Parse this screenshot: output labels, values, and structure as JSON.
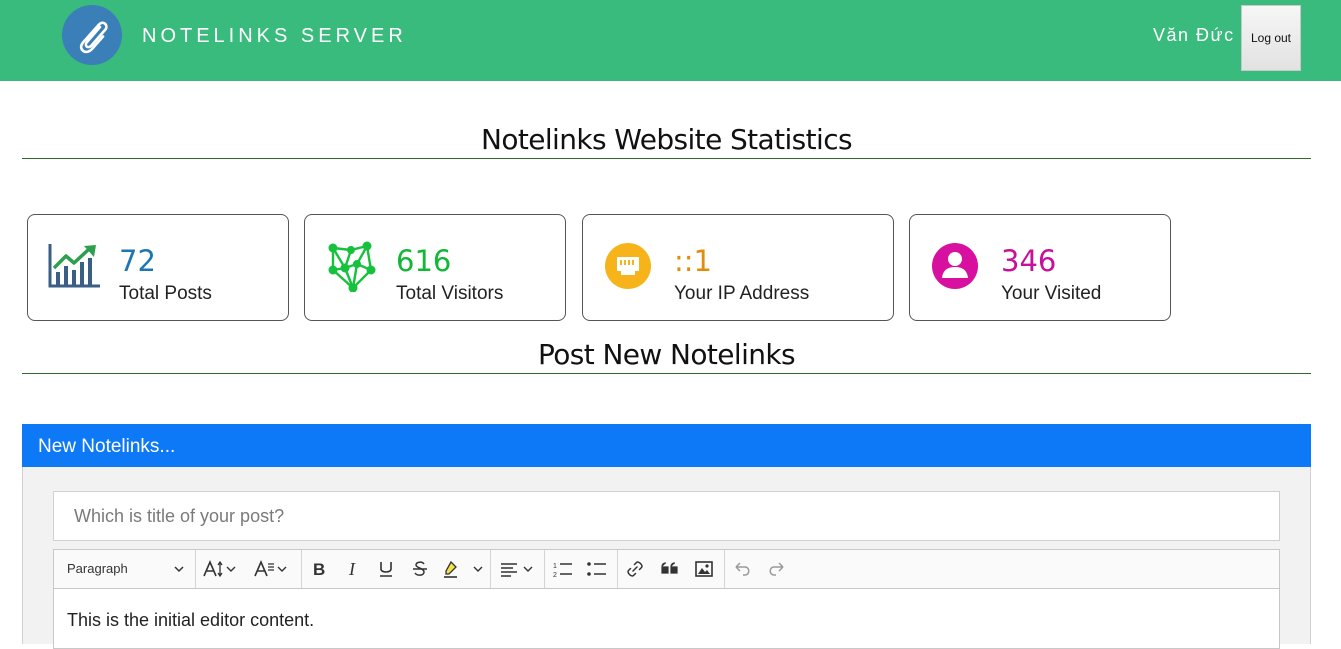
{
  "header": {
    "brand": "NOTELINKS SERVER",
    "username": "Văn Đức",
    "logout_label": "Log out",
    "logo_icon": "paperclip-icon",
    "bg_color": "#38bb7c"
  },
  "stats": {
    "title": "Notelinks Website Statistics",
    "cards": [
      {
        "icon": "chart-growth-icon",
        "value": "72",
        "label": "Total Posts",
        "color": "#1b76b3"
      },
      {
        "icon": "network-icon",
        "value": "616",
        "label": "Total Visitors",
        "color": "#12b737"
      },
      {
        "icon": "ethernet-port-icon",
        "value": "::1",
        "label": "Your IP Address",
        "color": "#e48c0a"
      },
      {
        "icon": "user-icon",
        "value": "346",
        "label": "Your Visited",
        "color": "#c7109c"
      }
    ]
  },
  "post": {
    "section_title": "Post New Notelinks",
    "panel_title": "New Notelinks...",
    "panel_color": "#0d79f7",
    "title_placeholder": "Which is title of your post?",
    "toolbar": {
      "paragraph_label": "Paragraph",
      "buttons": [
        "font-size-icon",
        "font-family-icon",
        "bold-icon",
        "italic-icon",
        "underline-icon",
        "strikethrough-icon",
        "highlight-icon",
        "align-icon",
        "numbered-list-icon",
        "bulleted-list-icon",
        "link-icon",
        "blockquote-icon",
        "image-icon",
        "undo-icon",
        "redo-icon"
      ]
    },
    "editor_content": "This is the initial editor content."
  }
}
